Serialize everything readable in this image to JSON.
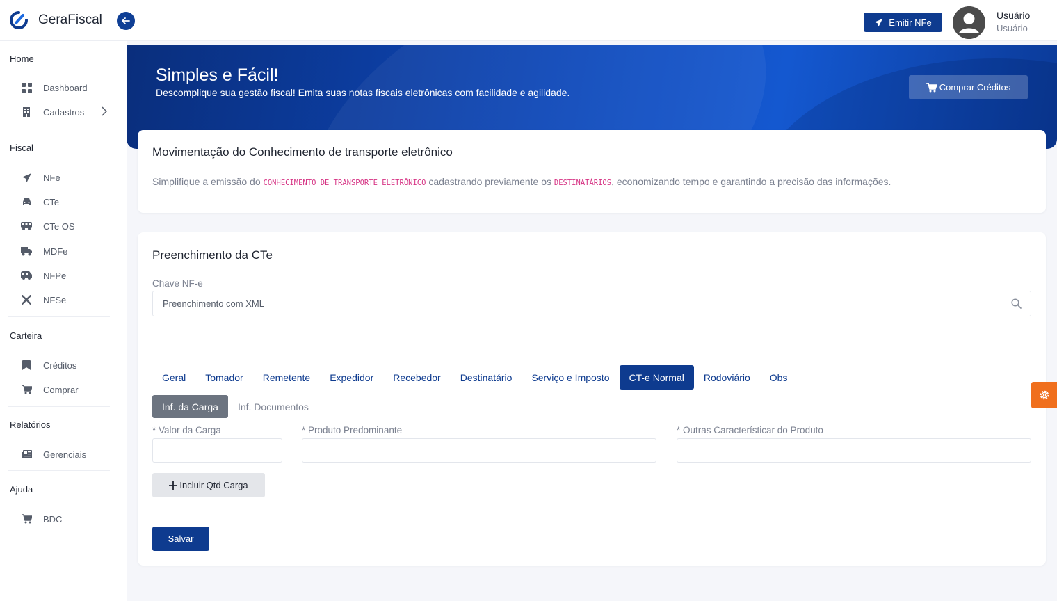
{
  "app": {
    "name": "GeraFiscal"
  },
  "header": {
    "emit_label": "Emitir NFe",
    "user_name": "Usuário",
    "user_role": "Usuário"
  },
  "sidebar": {
    "sections": [
      {
        "title": "Home",
        "items": [
          {
            "label": "Dashboard",
            "icon": "dashboard-icon"
          },
          {
            "label": "Cadastros",
            "icon": "building-icon",
            "has_submenu": true
          }
        ]
      },
      {
        "title": "Fiscal",
        "items": [
          {
            "label": "NFe",
            "icon": "paper-plane-icon"
          },
          {
            "label": "CTe",
            "icon": "car-icon"
          },
          {
            "label": "CTe OS",
            "icon": "bus-icon"
          },
          {
            "label": "MDFe",
            "icon": "truck-icon"
          },
          {
            "label": "NFPe",
            "icon": "van-icon"
          },
          {
            "label": "NFSe",
            "icon": "tools-icon"
          }
        ]
      },
      {
        "title": "Carteira",
        "items": [
          {
            "label": "Créditos",
            "icon": "bookmark-icon"
          },
          {
            "label": "Comprar",
            "icon": "cart-icon"
          }
        ]
      },
      {
        "title": "Relatórios",
        "items": [
          {
            "label": "Gerenciais",
            "icon": "newspaper-icon"
          }
        ]
      },
      {
        "title": "Ajuda",
        "items": [
          {
            "label": "BDC",
            "icon": "cart-icon"
          }
        ]
      }
    ]
  },
  "banner": {
    "title": "Simples e Fácil!",
    "subtitle": "Descomplique sua gestão fiscal! Emita suas notas fiscais eletrônicas com facilidade e agilidade.",
    "buy_label": "Comprar Créditos"
  },
  "intro": {
    "title": "Movimentação do Conhecimento de transporte eletrônico",
    "desc_1": "Simplifique a emissão do ",
    "code_1": "CONHECIMENTO DE TRANSPORTE ELETRÔNICO",
    "desc_2": " cadastrando previamente os ",
    "code_2": "DESTINATÁRIOS",
    "desc_3": ", economizando tempo e garantindo a precisão das informações."
  },
  "form": {
    "title": "Preenchimento da CTe",
    "chave_label": "Chave NF-e",
    "chave_placeholder": "Preenchimento com XML",
    "tabs": [
      "Geral",
      "Tomador",
      "Remetente",
      "Expedidor",
      "Recebedor",
      "Destinatário",
      "Serviço e Imposto",
      "CT-e Normal",
      "Rodoviário",
      "Obs"
    ],
    "active_tab": "CT-e Normal",
    "subtabs": [
      "Inf. da Carga",
      "Inf. Documentos"
    ],
    "active_subtab": "Inf. da Carga",
    "fields": {
      "valor_label": "* Valor da Carga",
      "produto_label": "* Produto Predominante",
      "outras_label": "* Outras Característicar do Produto"
    },
    "add_label": "Incluir Qtd Carga",
    "save_label": "Salvar"
  },
  "colors": {
    "primary": "#0e3b8f",
    "accent_orange": "#f06f1d",
    "code_pink": "#d63384"
  }
}
